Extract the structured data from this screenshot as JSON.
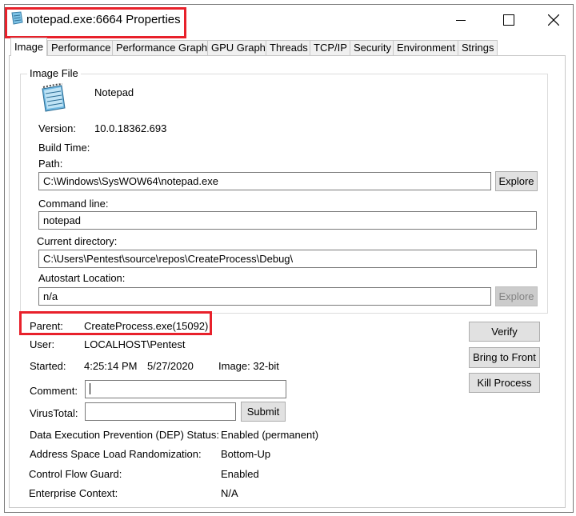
{
  "window": {
    "title": "notepad.exe:6664 Properties",
    "app_icon": "notepad-icon"
  },
  "tabs": [
    {
      "label": "Image",
      "active": true
    },
    {
      "label": "Performance"
    },
    {
      "label": "Performance Graph"
    },
    {
      "label": "GPU Graph"
    },
    {
      "label": "Threads"
    },
    {
      "label": "TCP/IP"
    },
    {
      "label": "Security"
    },
    {
      "label": "Environment"
    },
    {
      "label": "Strings"
    }
  ],
  "image_file": {
    "group_label": "Image File",
    "name": "Notepad",
    "version_label": "Version:",
    "version": "10.0.18362.693",
    "build_time_label": "Build Time:",
    "path_label": "Path:",
    "path": "C:\\Windows\\SysWOW64\\notepad.exe",
    "explore_label": "Explore",
    "command_line_label": "Command line:",
    "command_line": "notepad",
    "current_dir_label": "Current directory:",
    "current_dir": "C:\\Users\\Pentest\\source\\repos\\CreateProcess\\Debug\\",
    "autostart_label": "Autostart Location:",
    "autostart": "n/a",
    "explore2_label": "Explore"
  },
  "process": {
    "parent_label": "Parent:",
    "parent": "CreateProcess.exe(15092)",
    "user_label": "User:",
    "user": "LOCALHOST\\Pentest",
    "started_label": "Started:",
    "started_time": "4:25:14 PM",
    "started_date": "5/27/2020",
    "image_bits": "Image: 32-bit",
    "comment_label": "Comment:",
    "comment_value": "",
    "virustotal_label": "VirusTotal:",
    "virustotal_value": "",
    "submit_label": "Submit",
    "dep_label": "Data Execution Prevention (DEP) Status:",
    "dep_value": "Enabled (permanent)",
    "aslr_label": "Address Space Load Randomization:",
    "aslr_value": "Bottom-Up",
    "cfg_label": "Control Flow Guard:",
    "cfg_value": "Enabled",
    "enterprise_label": "Enterprise Context:",
    "enterprise_value": "N/A"
  },
  "actions": {
    "verify": "Verify",
    "bring_to_front": "Bring to Front",
    "kill": "Kill Process"
  },
  "colors": {
    "highlight": "#e8212b",
    "window_border": "#7a7a7a",
    "tab_bg": "#f0f0f0",
    "button_bg": "#e1e1e1"
  }
}
